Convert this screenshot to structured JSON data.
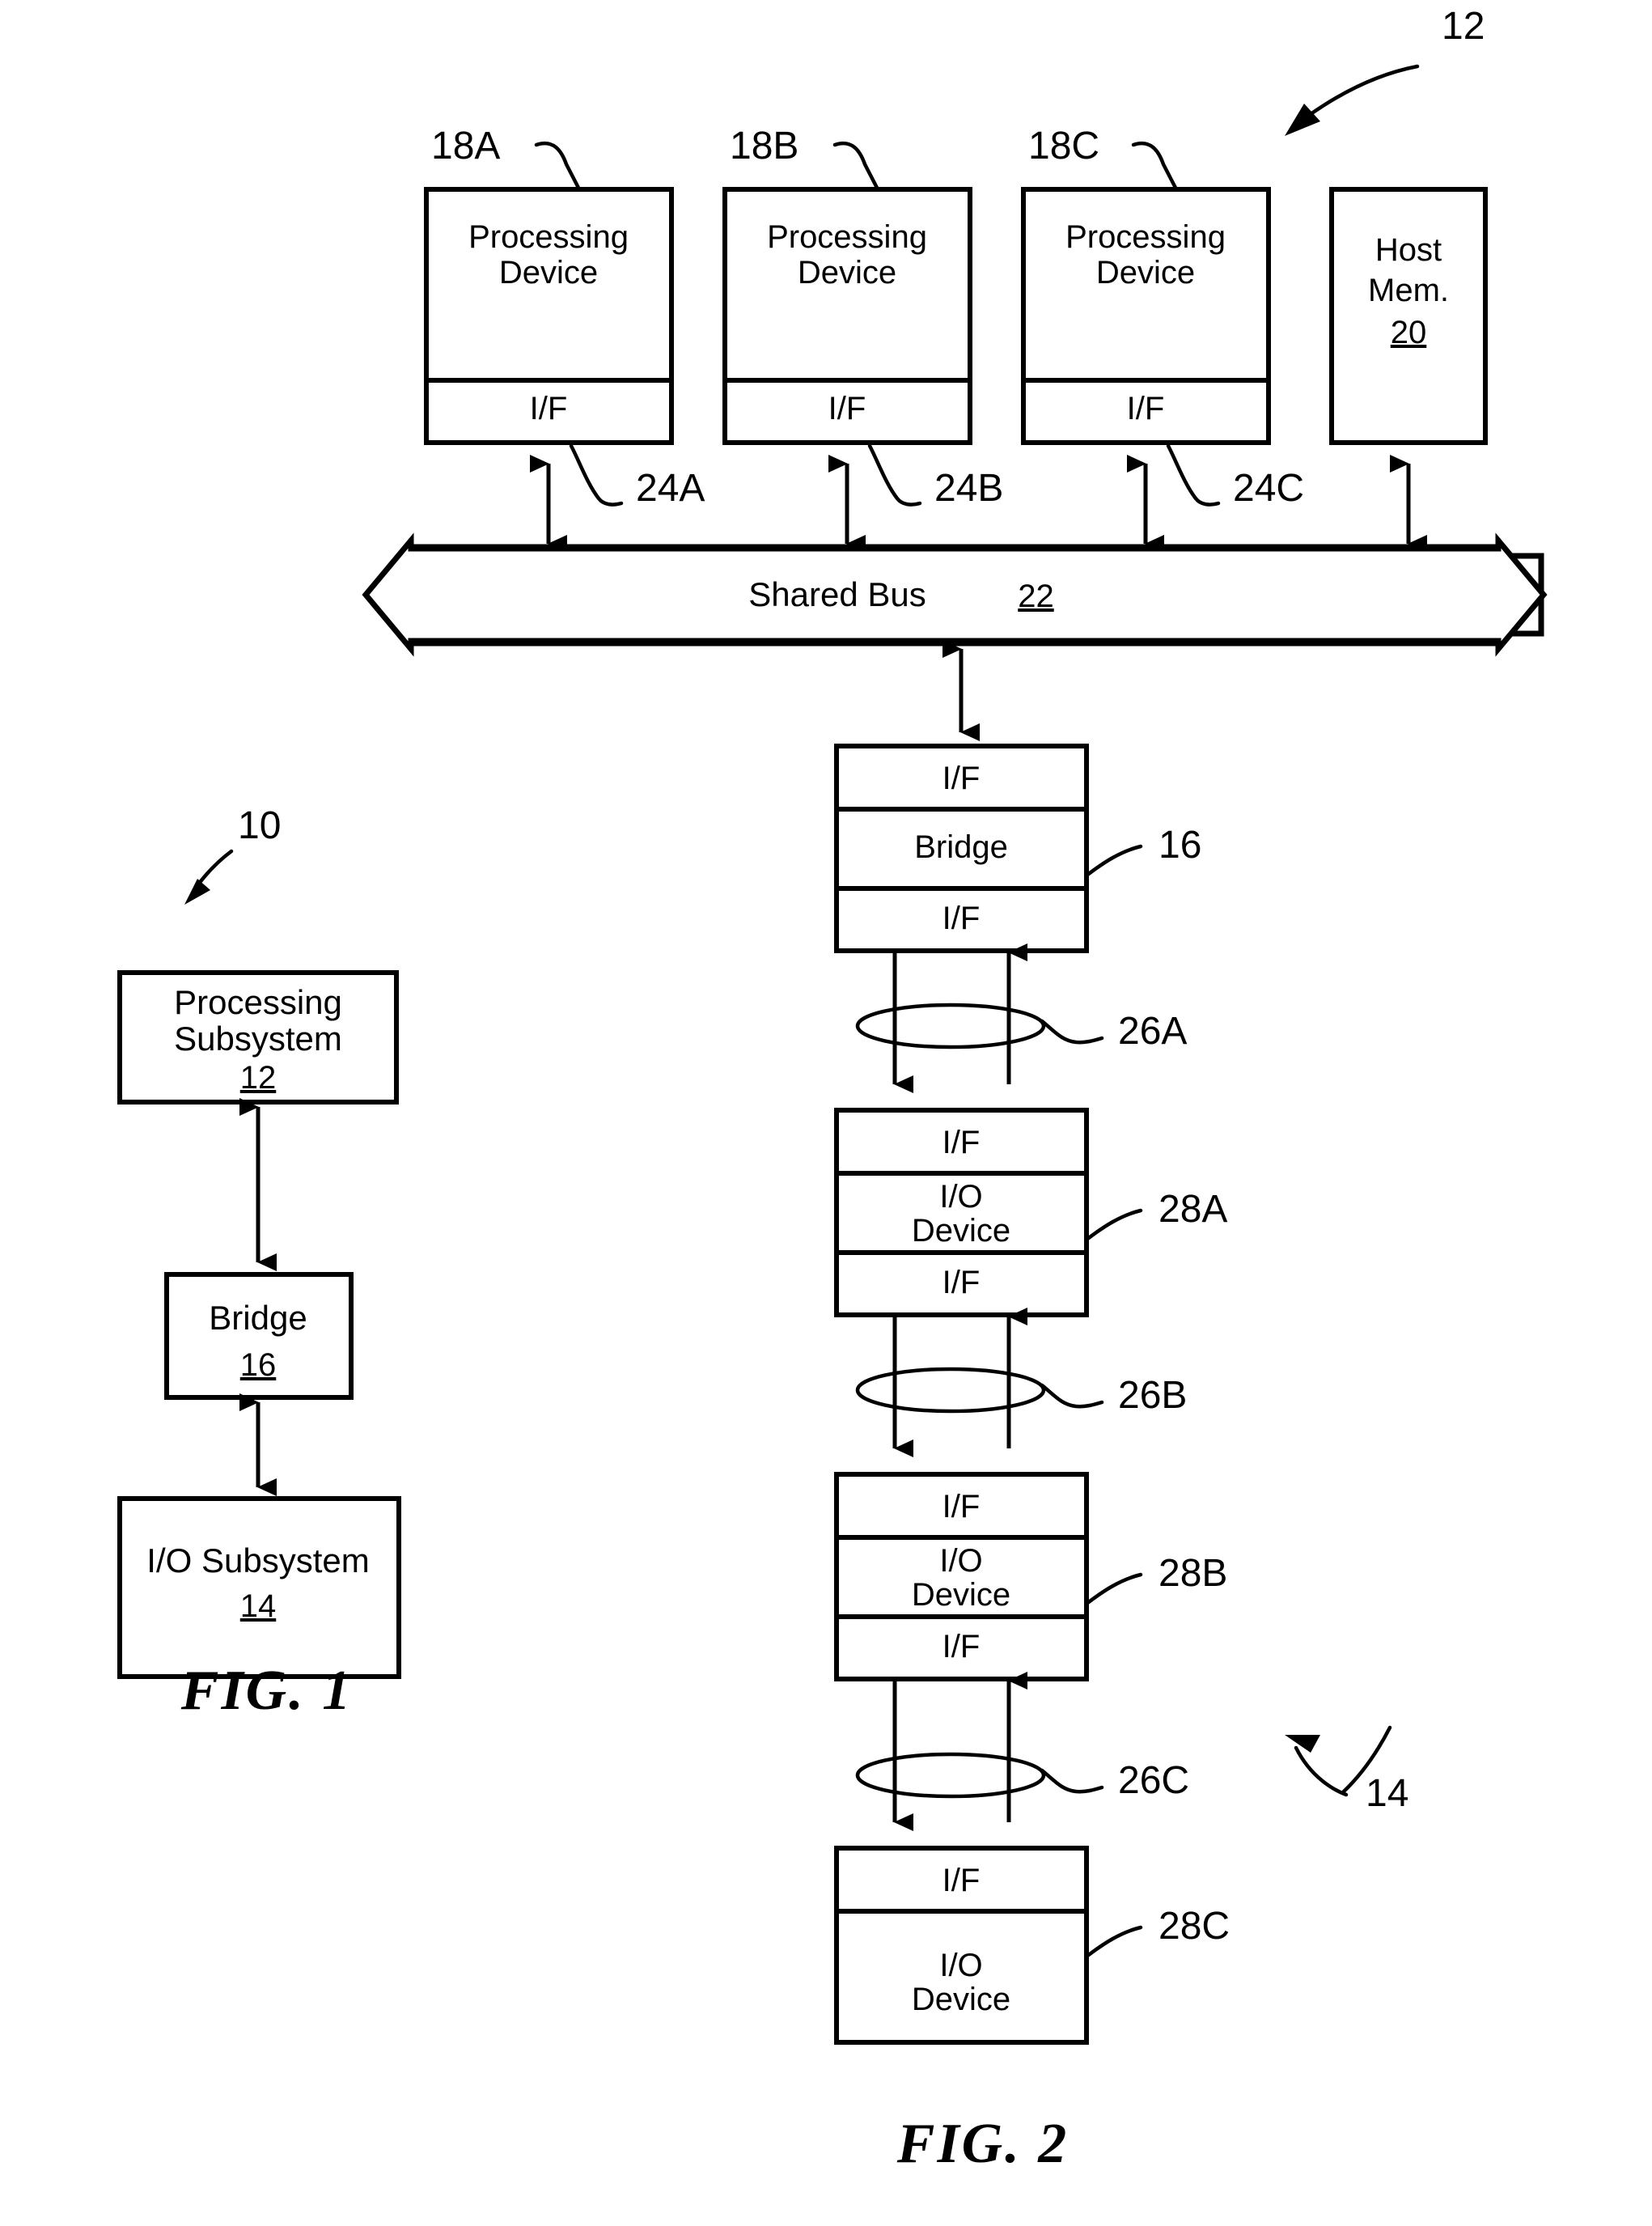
{
  "figure_page": {
    "title": "Patent drawing sheet with FIG. 1 and FIG. 2",
    "background_color": "#ffffff",
    "line_color": "#000000"
  },
  "fig1": {
    "caption": "FIG. 1",
    "system_ref": "10",
    "blocks": [
      {
        "label": "Processing Subsystem",
        "line1": "Processing",
        "line2": "Subsystem",
        "ref": "12"
      },
      {
        "label": "Bridge",
        "line1": "Bridge",
        "line2": "",
        "ref": "16"
      },
      {
        "label": "I/O Subsystem",
        "line1": "I/O Subsystem",
        "line2": "",
        "ref": "14"
      }
    ],
    "connectors": [
      {
        "from": "Processing Subsystem",
        "to": "Bridge",
        "style": "double-headed-arrow"
      },
      {
        "from": "Bridge",
        "to": "I/O Subsystem",
        "style": "double-headed-arrow"
      }
    ]
  },
  "fig2": {
    "caption": "FIG. 2",
    "processing_subsystem_ref": "12",
    "io_subsystem_ref": "14",
    "top_row": [
      {
        "name": "Processing Device",
        "line1": "Processing",
        "line2": "Device",
        "ref": "18A",
        "iface_label": "I/F",
        "link_ref": "24A"
      },
      {
        "name": "Processing Device",
        "line1": "Processing",
        "line2": "Device",
        "ref": "18B",
        "iface_label": "I/F",
        "link_ref": "24B"
      },
      {
        "name": "Processing Device",
        "line1": "Processing",
        "line2": "Device",
        "ref": "18C",
        "iface_label": "I/F",
        "link_ref": "24C"
      }
    ],
    "host_memory": {
      "line1": "Host",
      "line2": "Mem.",
      "ref": "20"
    },
    "bus": {
      "label": "Shared Bus",
      "ref": "22"
    },
    "bridge": {
      "label": "Bridge",
      "ref": "16",
      "iface_top": "I/F",
      "iface_bottom": "I/F"
    },
    "links": [
      {
        "ref": "26A"
      },
      {
        "ref": "26B"
      },
      {
        "ref": "26C"
      }
    ],
    "io_devices": [
      {
        "line1": "I/O",
        "line2": "Device",
        "ref": "28A",
        "iface_top": "I/F",
        "iface_bottom": "I/F"
      },
      {
        "line1": "I/O",
        "line2": "Device",
        "ref": "28B",
        "iface_top": "I/F",
        "iface_bottom": "I/F"
      },
      {
        "line1": "I/O",
        "line2": "Device",
        "ref": "28C",
        "iface_top": "I/F",
        "iface_bottom": ""
      }
    ]
  }
}
